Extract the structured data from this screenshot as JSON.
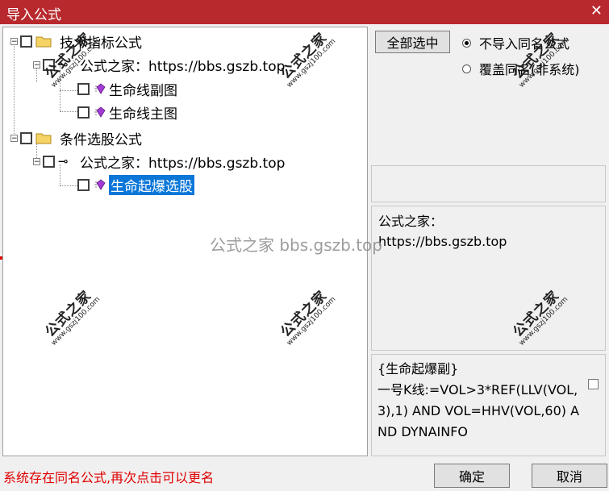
{
  "window": {
    "title": "导入公式",
    "close_glyph": "✕"
  },
  "tree": {
    "group1_label": "技术指标公式",
    "group1_site": "公式之家：https://bbs.gszb.top",
    "group1_item1": "生命线副图",
    "group1_item2": "生命线主图",
    "group2_label": "条件选股公式",
    "group2_site": "公式之家：https://bbs.gszb.top",
    "group2_item1": "生命起爆选股",
    "expander_glyph": "−"
  },
  "options": {
    "select_all_label": "全部选中",
    "radio1_label": "不导入同名公式",
    "radio2_label": "覆盖同名(非系统)",
    "selected": "radio1"
  },
  "info": {
    "line1": "公式之家：",
    "line2": "https://bbs.gszb.top"
  },
  "formula": {
    "text": "{生命起爆副}\n一号K线:=VOL>3*REF(LLV(VOL,3),1) AND VOL=HHV(VOL,60) AND DYNAINFO"
  },
  "footer": {
    "status": "系统存在同名公式,再次点击可以更名",
    "ok_label": "确定",
    "cancel_label": "取消"
  },
  "watermark": {
    "center": "公式之家 bbs.gszb.top",
    "stamp_title": "公式之家",
    "stamp_url": "www.gszj100.com"
  },
  "colors": {
    "title_bar": "#b8292e",
    "selection": "#0a76d8",
    "status_text": "#e00000"
  }
}
